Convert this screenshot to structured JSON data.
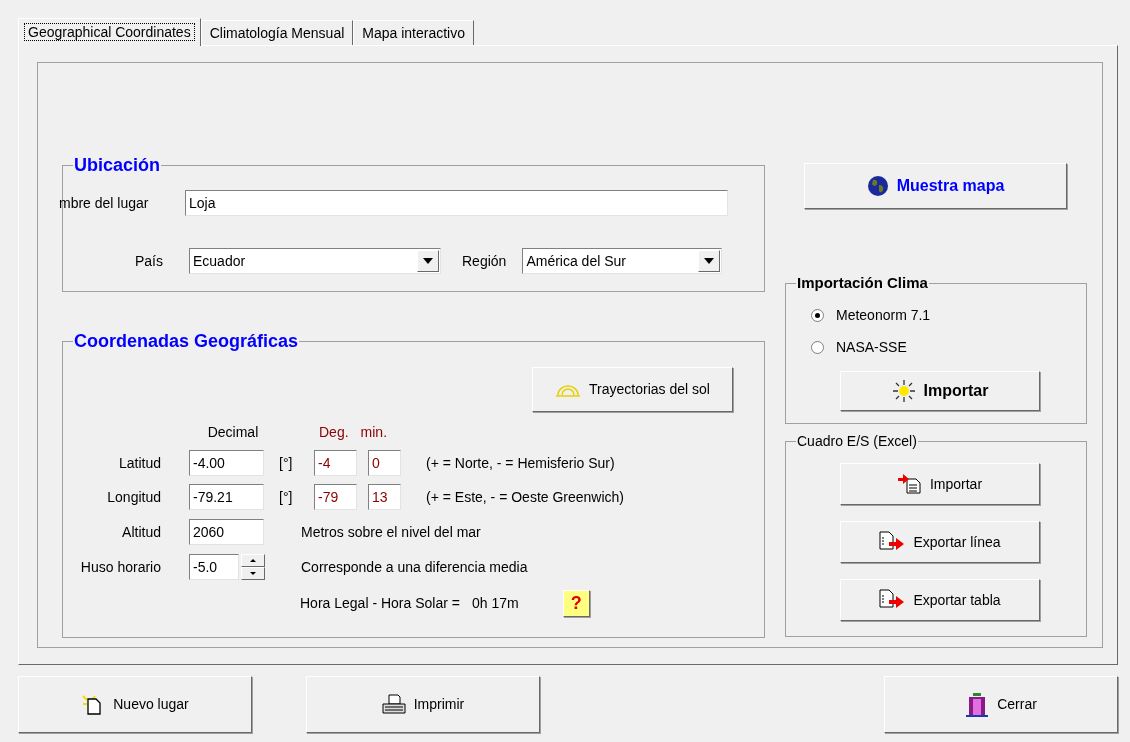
{
  "tabs": [
    {
      "label": "Geographical Coordinates",
      "selected": true
    },
    {
      "label": "Climatología Mensual",
      "selected": false
    },
    {
      "label": "Mapa interactivo",
      "selected": false
    }
  ],
  "ubicacion": {
    "title": "Ubicación",
    "name_label": "mbre del lugar",
    "name_value": "Loja",
    "country_label": "País",
    "country_value": "Ecuador",
    "region_label": "Región",
    "region_value": "América del Sur"
  },
  "coordenadas": {
    "title": "Coordenadas Geográficas",
    "sun_button": "Trayectorias del sol",
    "headers": [
      "Decimal",
      "Deg.",
      "min."
    ],
    "rows": [
      {
        "label": "Latitud",
        "decimal": "-4.00",
        "unit": "[°]",
        "deg": "-4",
        "min": "0",
        "note": "(+ = Norte, - = Hemisferio Sur)"
      },
      {
        "label": "Longitud",
        "decimal": "-79.21",
        "unit": "[°]",
        "deg": "-79",
        "min": "13",
        "note": "(+ = Este, - = Oeste Greenwich)"
      }
    ],
    "altitude": {
      "label": "Altitud",
      "value": "2060",
      "note": "Metros sobre el nivel del mar"
    },
    "timezone": {
      "label": "Huso horario",
      "value": "-5.0",
      "note": "Corresponde a una diferencia media"
    },
    "solar_diff": {
      "label": "Hora Legal - Hora Solar =",
      "value": "0h 17m"
    },
    "help_button": "?"
  },
  "map_button": "Muestra mapa",
  "climate_import": {
    "title": "Importación Clima",
    "options": [
      {
        "label": "Meteonorm 7.1",
        "selected": true
      },
      {
        "label": "NASA-SSE",
        "selected": false
      }
    ],
    "button": "Importar"
  },
  "excel": {
    "title": "Cuadro E/S (Excel)",
    "buttons": [
      {
        "kind": "import",
        "label": "Importar"
      },
      {
        "kind": "export",
        "label": "Exportar línea"
      },
      {
        "kind": "export",
        "label": "Exportar tabla"
      }
    ]
  },
  "footer_buttons": [
    {
      "kind": "new",
      "label": "Nuevo lugar"
    },
    {
      "kind": "print",
      "label": "Imprimir"
    },
    {
      "kind": "close",
      "label": "Cerrar"
    }
  ]
}
